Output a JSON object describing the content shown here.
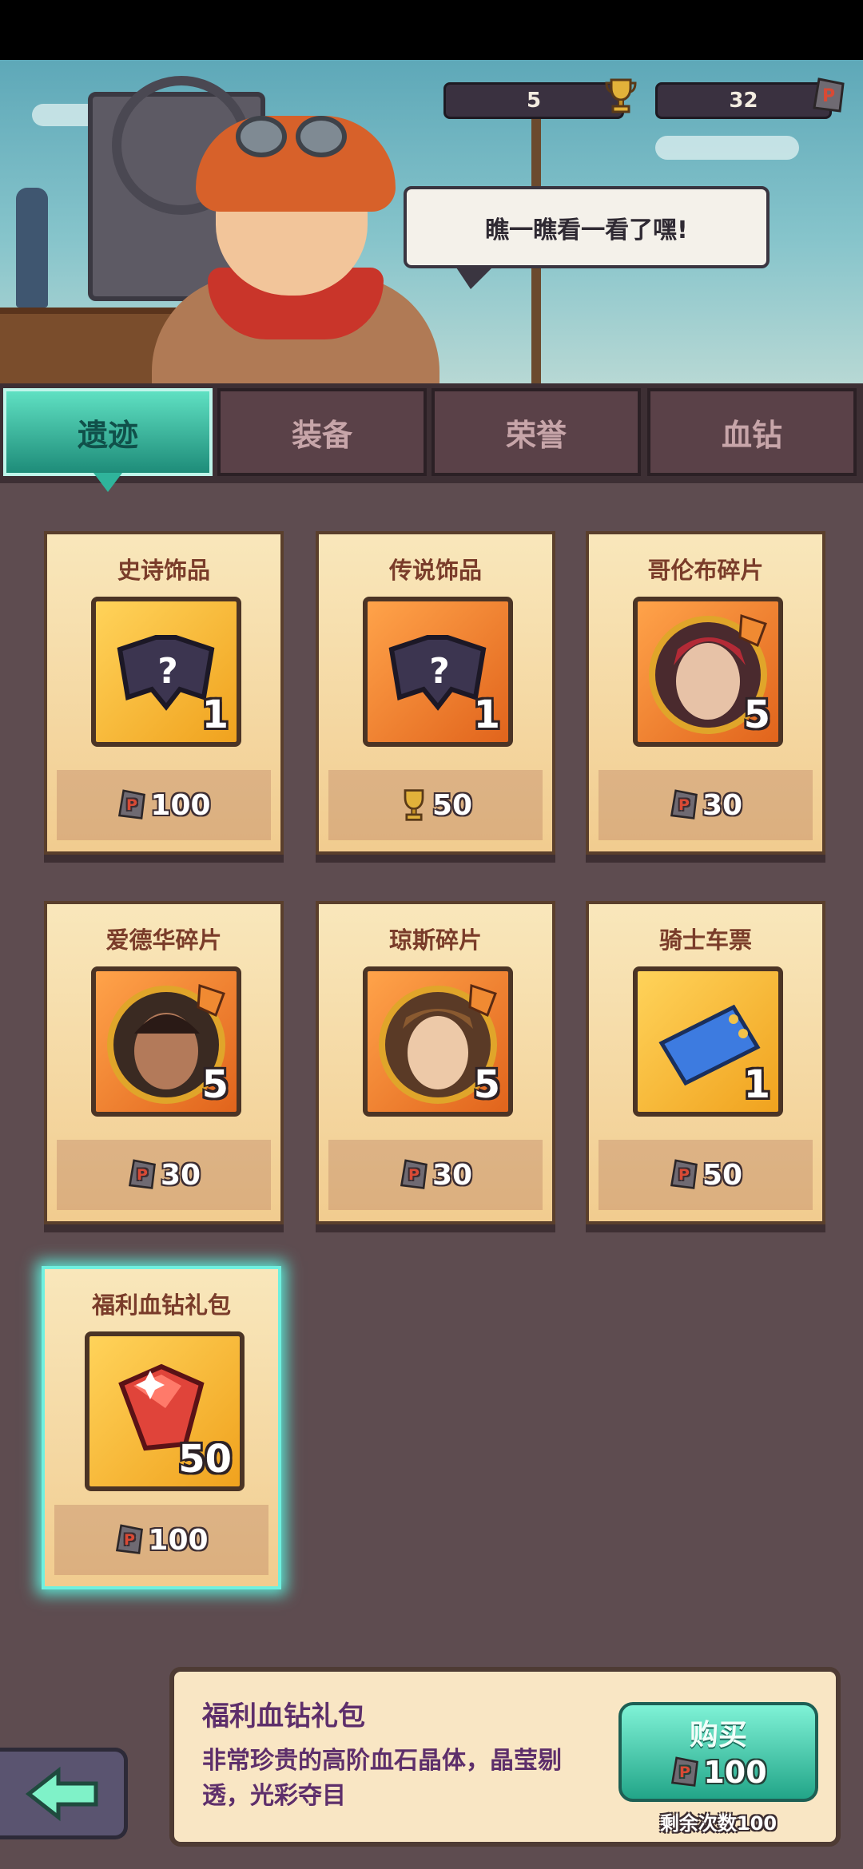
{
  "resources": {
    "trophy": {
      "value": "5",
      "icon": "trophy-icon"
    },
    "blood_diamond": {
      "value": "32",
      "icon": "blood-stone-icon"
    }
  },
  "npc": {
    "speech": "瞧一瞧看一看了嘿!"
  },
  "tabs": [
    {
      "label": "遗迹",
      "active": true
    },
    {
      "label": "装备",
      "active": false
    },
    {
      "label": "荣誉",
      "active": false
    },
    {
      "label": "血钻",
      "active": false
    }
  ],
  "items": [
    {
      "name": "史诗饰品",
      "count": "1",
      "price": "100",
      "currency": "blood-stone-icon",
      "icon": "mystery-mask-icon"
    },
    {
      "name": "传说饰品",
      "count": "1",
      "price": "50",
      "currency": "trophy-icon",
      "icon": "mystery-mask-icon"
    },
    {
      "name": "哥伦布碎片",
      "count": "5",
      "price": "30",
      "currency": "blood-stone-icon",
      "icon": "hero-portrait-icon"
    },
    {
      "name": "爱德华碎片",
      "count": "5",
      "price": "30",
      "currency": "blood-stone-icon",
      "icon": "hero-portrait-icon"
    },
    {
      "name": "琼斯碎片",
      "count": "5",
      "price": "30",
      "currency": "blood-stone-icon",
      "icon": "hero-portrait-icon"
    },
    {
      "name": "骑士车票",
      "count": "1",
      "price": "50",
      "currency": "blood-stone-icon",
      "icon": "ticket-icon"
    },
    {
      "name": "福利血钻礼包",
      "count": "50",
      "price": "100",
      "currency": "blood-stone-icon",
      "icon": "red-gem-icon",
      "selected": true
    }
  ],
  "detail": {
    "title": "福利血钻礼包",
    "description": "非常珍贵的高阶血石晶体，晶莹剔透，光彩夺目",
    "buy_label": "购买",
    "price": "100",
    "remaining": "剩余次数100"
  },
  "colors": {
    "active_tab": "#2fb49b",
    "selected_glow": "#5be6d3",
    "title_text": "#7a3c2a",
    "detail_text": "#5e2f6b"
  }
}
